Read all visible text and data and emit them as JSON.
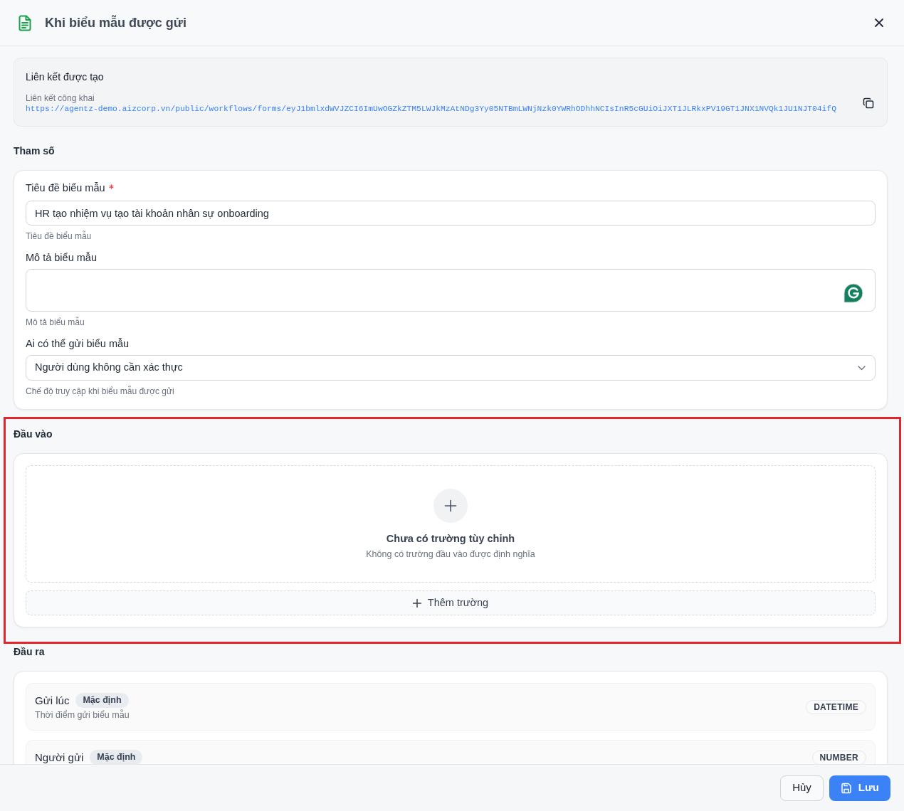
{
  "header": {
    "title": "Khi biểu mẫu được gửi"
  },
  "link_card": {
    "title": "Liên kết được tạo",
    "label": "Liên kết công khai",
    "url": "https://agentz-demo.aizcorp.vn/public/workflows/forms/eyJ1bmlxdWVJZCI6ImUwOGZkZTM5LWJkMzAtNDg3Yy05NTBmLWNjNzk0YWRhODhhNCIsInR5cGUiOiJXT1JLRkxPV19GT1JNX1NVQk1JU1NJT04ifQ"
  },
  "parameters": {
    "heading": "Tham số",
    "fields": [
      {
        "kind": "text",
        "label": "Tiêu đề biểu mẫu",
        "required": true,
        "value": "HR tạo nhiệm vụ tạo tài khoản nhân sự onboarding",
        "help": "Tiêu đề biểu mẫu"
      },
      {
        "kind": "textarea",
        "label": "Mô tả biểu mẫu",
        "required": false,
        "help": "Mô tả biểu mẫu"
      },
      {
        "kind": "select",
        "label": "Ai có thể gửi biểu mẫu",
        "required": false,
        "value": "Người dùng không cần xác thực",
        "help": "Chế độ truy cập khi biểu mẫu được gửi"
      }
    ]
  },
  "inputs": {
    "heading": "Đầu vào",
    "highlighted": true,
    "empty_title": "Chưa có trường tùy chỉnh",
    "empty_text": "Không có trường đầu vào được định nghĩa",
    "add_button": "Thêm trường"
  },
  "outputs": {
    "heading": "Đầu ra",
    "items": [
      {
        "name": "Gửi lúc",
        "badge": "Mặc định",
        "description": "Thời điểm gửi biểu mẫu",
        "type": "DATETIME"
      },
      {
        "name": "Người gửi",
        "badge": "Mặc định",
        "type": "NUMBER"
      }
    ]
  },
  "footer": {
    "buttons": [
      {
        "kind": "secondary",
        "label": "Hủy"
      },
      {
        "kind": "primary",
        "label": "Lưu"
      }
    ]
  }
}
